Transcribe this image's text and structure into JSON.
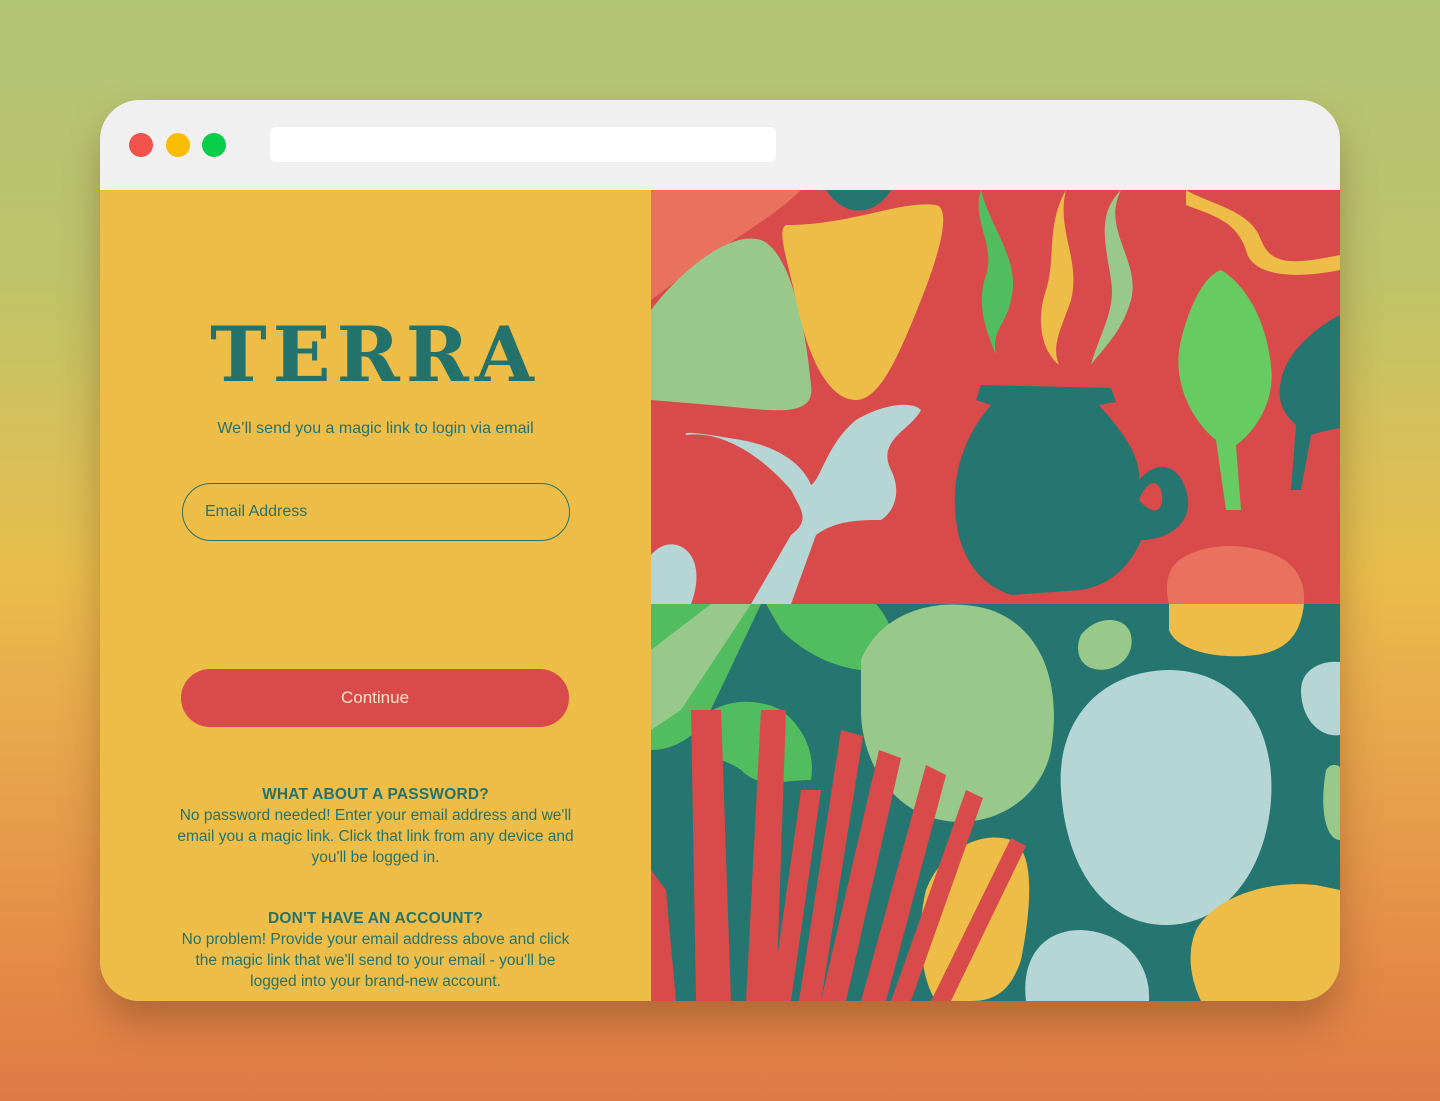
{
  "browser": {
    "buttons": [
      "close",
      "minimize",
      "maximize"
    ],
    "address_value": ""
  },
  "brand": {
    "name": "TERRA"
  },
  "login": {
    "tagline": "We’ll send you a magic link to login via email",
    "email_placeholder": "Email Address",
    "continue_label": "Continue"
  },
  "faq": [
    {
      "title": "WHAT ABOUT A PASSWORD?",
      "body": "No password needed! Enter your email address and we'll email you a magic link. Click that link from any device and you'll be logged in."
    },
    {
      "title": "DON'T HAVE AN ACCOUNT?",
      "body": "No problem! Provide your email address above and click the magic link that we'll send to your email - you'll be logged into your brand-new account."
    }
  ],
  "colors": {
    "panel_yellow": "#eebd48",
    "brand_teal": "#23736c",
    "button_red": "#d84b4a",
    "art_red": "#d84b4a",
    "art_teal": "#257570",
    "art_green": "#52bd5e",
    "art_light_green": "#98c98a",
    "art_pale_blue": "#b6d6d6",
    "art_salmon": "#e8725d"
  },
  "icons": [
    "close-dot-icon",
    "minimize-dot-icon",
    "maximize-dot-icon",
    "terra-logo",
    "abstract-illustration"
  ]
}
